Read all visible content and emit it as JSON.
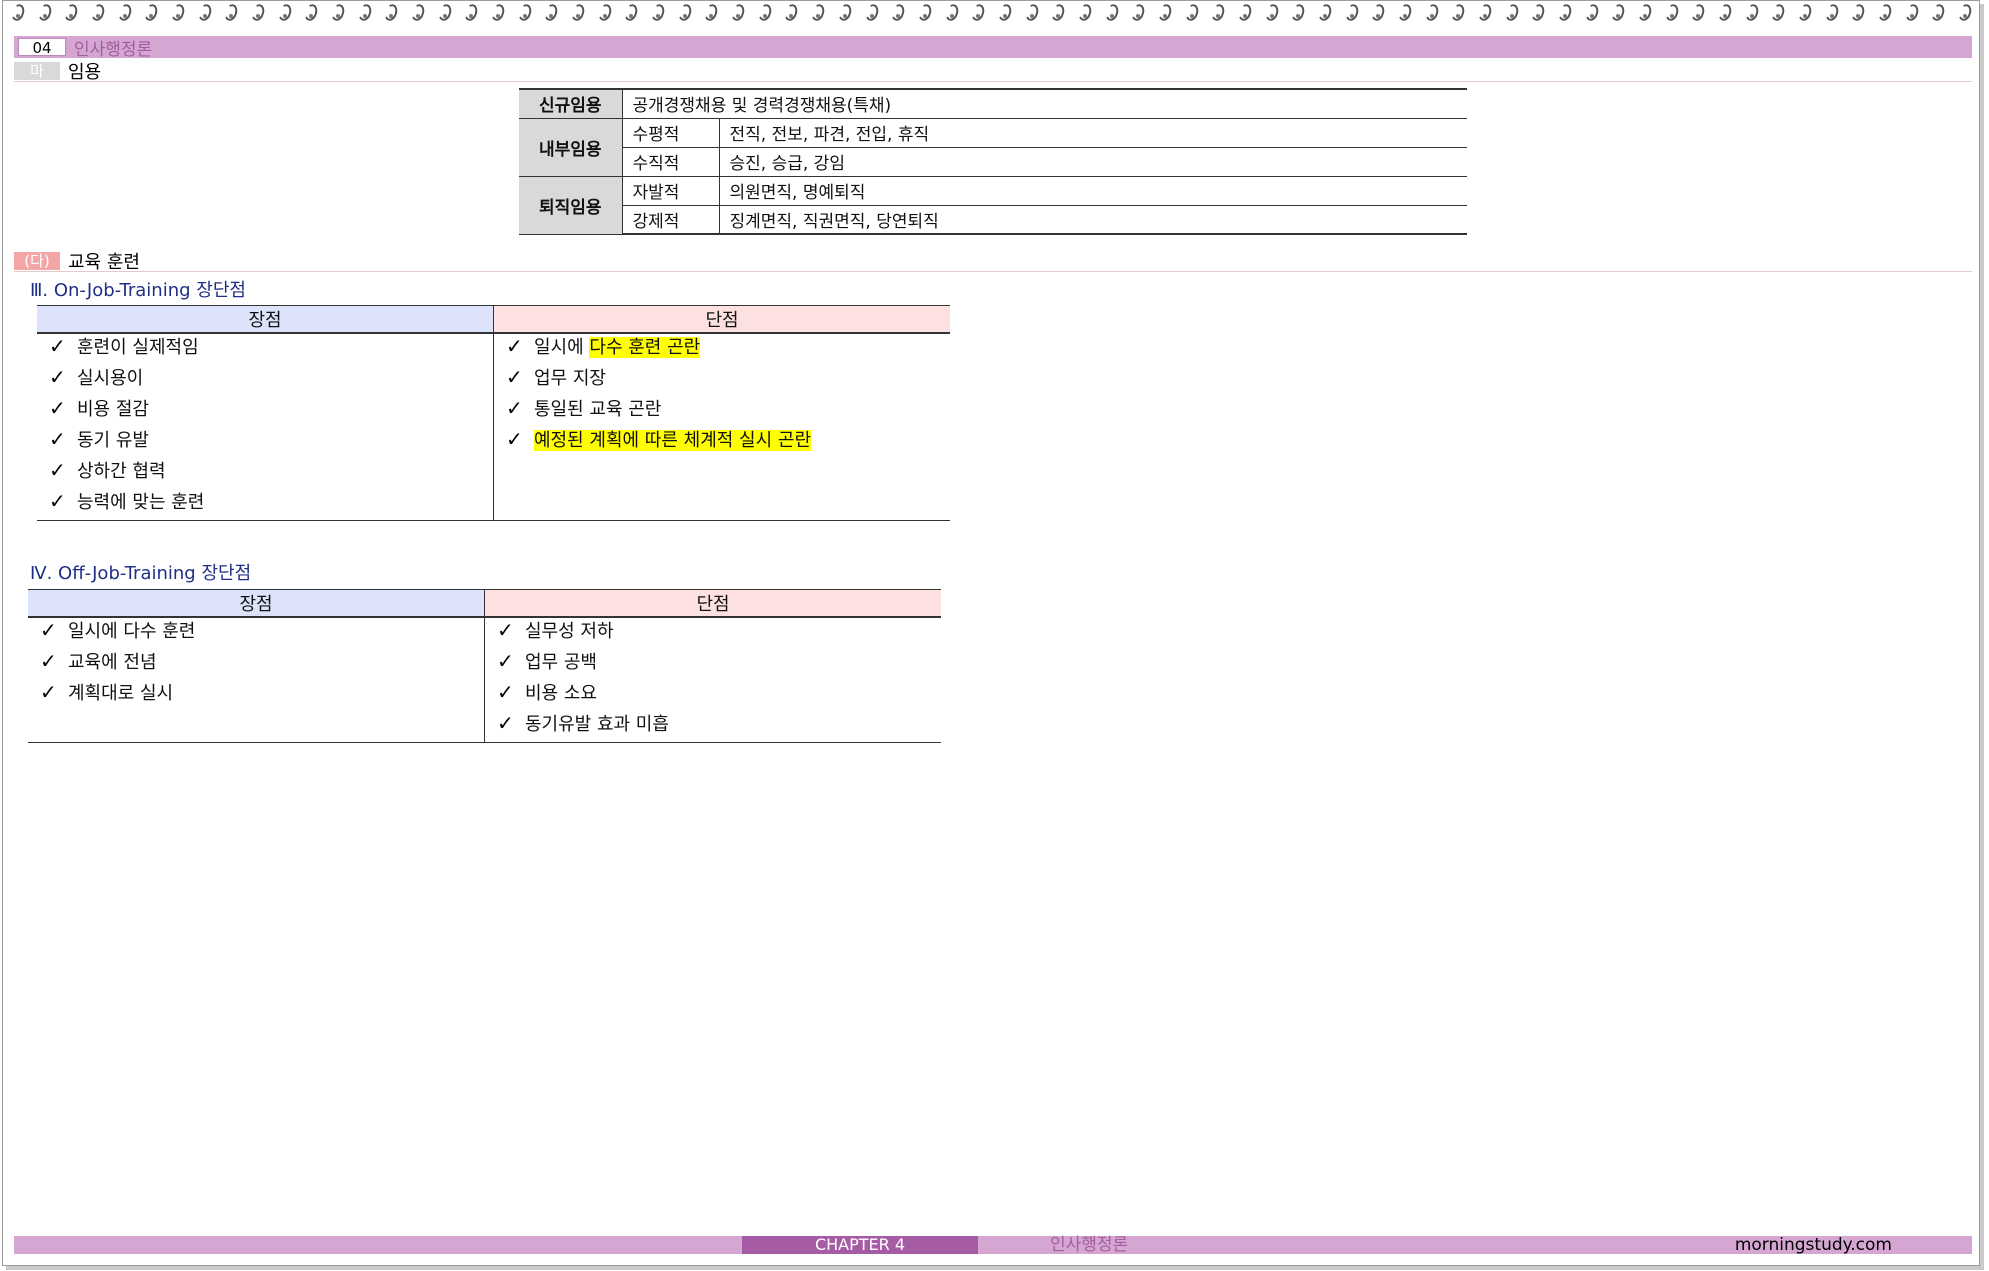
{
  "header": {
    "chapter_num": "04",
    "chapter_title": "인사행정론"
  },
  "section_ma": {
    "mark": "마",
    "label": "임용"
  },
  "appointment_table": {
    "rows": [
      {
        "head": "신규임용",
        "sub": "",
        "value": "공개경쟁채용 및 경력경쟁채용(특채)"
      },
      {
        "head": "내부임용",
        "sub": "수평적",
        "value": "전직, 전보, 파견, 전입, 휴직"
      },
      {
        "head": "",
        "sub": "수직적",
        "value": "승진, 승급, 강임"
      },
      {
        "head": "퇴직임용",
        "sub": "자발적",
        "value": "의원면직, 명예퇴직"
      },
      {
        "head": "",
        "sub": "강제적",
        "value": "징계면직, 직권면직, 당연퇴직"
      }
    ]
  },
  "section_da": {
    "mark": "(다)",
    "label": "교육 훈련"
  },
  "ojt": {
    "heading": "Ⅲ. On-Job-Training 장단점",
    "pros_header": "장점",
    "cons_header": "단점",
    "pros": [
      "훈련이 실제적임",
      "실시용이",
      "비용 절감",
      "동기 유발",
      "상하간 협력",
      "능력에 맞는 훈련"
    ],
    "cons": [
      {
        "plain": "일시에 ",
        "highlight": "다수 훈련 곤란"
      },
      {
        "plain": "업무 지장",
        "highlight": ""
      },
      {
        "plain": "통일된 교육 곤란",
        "highlight": ""
      },
      {
        "plain": "",
        "highlight": "예정된 계획에 따른 체계적 실시 곤란"
      }
    ]
  },
  "offjt": {
    "heading": "Ⅳ. Off-Job-Training 장단점",
    "pros_header": "장점",
    "cons_header": "단점",
    "pros": [
      "일시에 다수 훈련",
      "교육에 전념",
      "계획대로 실시"
    ],
    "cons": [
      "실무성 저하",
      "업무 공백",
      "비용 소요",
      "동기유발 효과 미흡"
    ]
  },
  "check_symbol": "✓",
  "footer": {
    "chapter": "CHAPTER  4",
    "subject": "인사행정론",
    "site": "morningstudy.com"
  }
}
